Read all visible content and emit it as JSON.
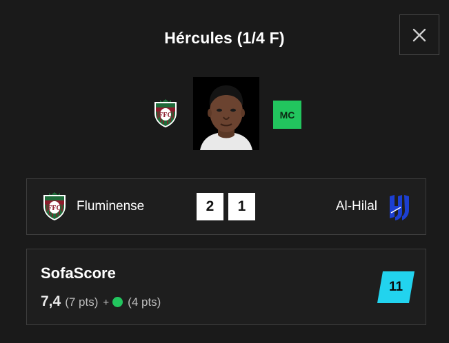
{
  "modal": {
    "title": "Hércules (1/4 F)",
    "close_icon": "close-icon"
  },
  "player": {
    "position": "MC",
    "team_crest": "fluminense-crest-icon",
    "photo": "player-photo"
  },
  "match": {
    "home_team": "Fluminense",
    "away_team": "Al-Hilal",
    "home_score": "2",
    "away_score": "1",
    "home_crest": "fluminense-crest-icon",
    "away_crest": "al-hilal-crest-icon"
  },
  "rating": {
    "title": "SofaScore",
    "value": "7,4",
    "pts": "(7 pts)",
    "plus": "+",
    "bonus_pts": "(4 pts)",
    "total": "11"
  },
  "colors": {
    "background": "#1a1a1a",
    "accent_green": "#22c55e",
    "badge_cyan": "#22d3ee",
    "fluminense_maroon": "#8b1c2c",
    "fluminense_green": "#1f6b3a",
    "alhilal_blue": "#1c3fd1"
  }
}
